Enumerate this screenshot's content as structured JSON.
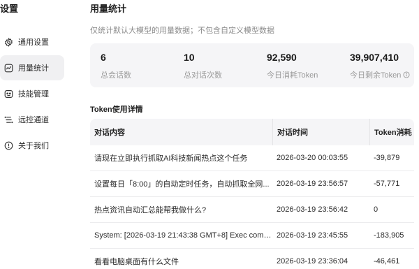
{
  "app": {
    "title": "设置"
  },
  "sidebar": {
    "items": [
      {
        "label": "通用设置",
        "icon": "gear-icon",
        "active": false
      },
      {
        "label": "用量统计",
        "icon": "chart-icon",
        "active": true
      },
      {
        "label": "技能管理",
        "icon": "skill-icon",
        "active": false
      },
      {
        "label": "远控通道",
        "icon": "remote-icon",
        "active": false
      },
      {
        "label": "关于我们",
        "icon": "info-icon",
        "active": false
      }
    ]
  },
  "main": {
    "title": "用量统计",
    "subtitle": "仅统计默认大模型的用量数据；不包含自定义模型数据",
    "stats": [
      {
        "value": "6",
        "label": "总会话数"
      },
      {
        "value": "10",
        "label": "总对话次数"
      },
      {
        "value": "92,590",
        "label": "今日消耗Token"
      },
      {
        "value": "39,907,410",
        "label": "今日剩余Token"
      }
    ],
    "details_title": "Token使用详情",
    "table": {
      "headers": [
        "对话内容",
        "对话时间",
        "Token消耗"
      ],
      "rows": [
        {
          "content": "请现在立即执行抓取AI科技新闻热点这个任务",
          "time": "2026-03-20 00:03:55",
          "tokens": "-39,879"
        },
        {
          "content": "设置每日「8:00」的自动定时任务，自动抓取全网...",
          "time": "2026-03-19 23:56:57",
          "tokens": "-57,771"
        },
        {
          "content": "热点资讯自动汇总能帮我做什么?",
          "time": "2026-03-19 23:56:42",
          "tokens": "0"
        },
        {
          "content": "System: [2026-03-19 21:43:38 GMT+8] Exec compl...",
          "time": "2026-03-19 23:45:55",
          "tokens": "-183,905"
        },
        {
          "content": "看看电脑桌面有什么文件",
          "time": "2026-03-19 23:36:04",
          "tokens": "-46,461"
        }
      ]
    }
  },
  "colors": {
    "panel_bg": "#f5f5f7",
    "active_nav_bg": "#f0f0f2",
    "muted_text": "#8a8a8a"
  }
}
